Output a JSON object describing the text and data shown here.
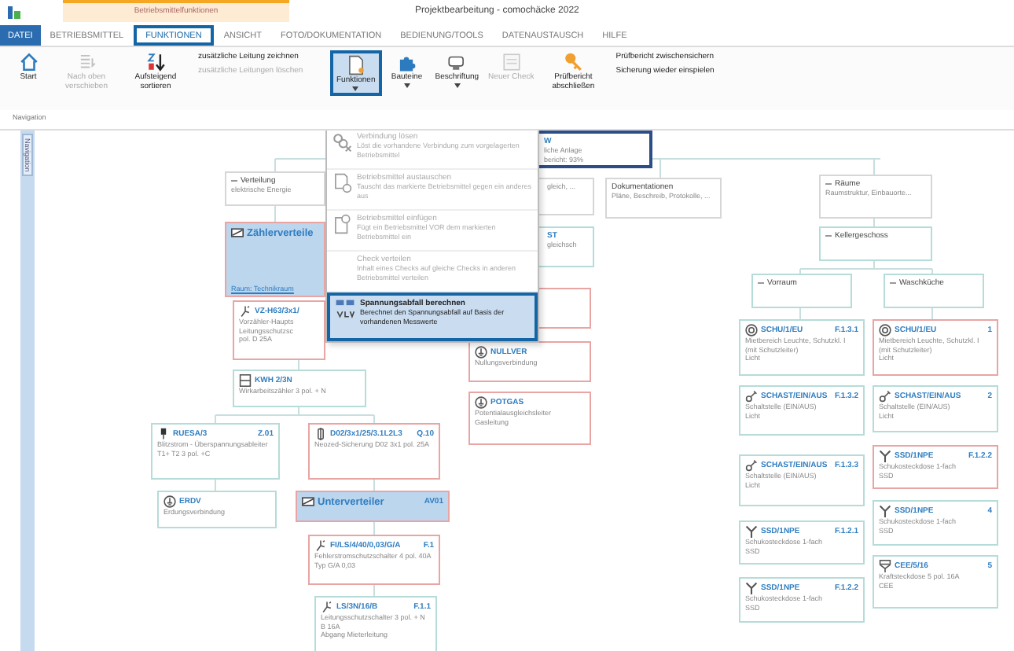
{
  "window": {
    "context_tab": "Betriebsmittelfunktionen",
    "title": "Projektbearbeitung - comochäcke 2022"
  },
  "tabs": [
    {
      "label": "DATEI",
      "kind": "file",
      "selected": false
    },
    {
      "label": "BETRIEBSMITTEL",
      "kind": "tab",
      "selected": false
    },
    {
      "label": "FUNKTIONEN",
      "kind": "tab",
      "selected": true
    },
    {
      "label": "ANSICHT",
      "kind": "tab",
      "selected": false
    },
    {
      "label": "FOTO/DOKUMENTATION",
      "kind": "tab",
      "selected": false
    },
    {
      "label": "BEDIENUNG/TOOLS",
      "kind": "tab",
      "selected": false
    },
    {
      "label": "DATENAUSTAUSCH",
      "kind": "tab",
      "selected": false
    },
    {
      "label": "HILFE",
      "kind": "tab",
      "selected": false
    }
  ],
  "ribbon": {
    "group_label": "Navigation",
    "items": [
      {
        "kind": "large",
        "label": "Start",
        "disabled": false,
        "selected": false,
        "dropdown": false
      },
      {
        "kind": "large",
        "label": "Nach oben verschieben",
        "disabled": true,
        "selected": false,
        "dropdown": false
      },
      {
        "kind": "large",
        "label": "Aufsteigend sortieren",
        "disabled": false,
        "selected": false,
        "dropdown": false
      },
      {
        "kind": "stack",
        "entries": [
          {
            "label": "zusätzliche Leitung zeichnen",
            "disabled": false
          },
          {
            "label": "zusätzliche Leitungen löschen",
            "disabled": true
          }
        ]
      },
      {
        "kind": "large",
        "label": "Funktionen",
        "disabled": false,
        "selected": true,
        "dropdown": true
      },
      {
        "kind": "large",
        "label": "Bauteine",
        "disabled": false,
        "selected": false,
        "dropdown": true
      },
      {
        "kind": "large",
        "label": "Beschriftung",
        "disabled": false,
        "selected": false,
        "dropdown": true
      },
      {
        "kind": "large",
        "label": "Neuer Check",
        "disabled": true,
        "selected": false,
        "dropdown": false
      },
      {
        "kind": "large",
        "label": "Prüfbericht abschließen",
        "disabled": false,
        "selected": false,
        "dropdown": false
      },
      {
        "kind": "stack",
        "entries": [
          {
            "label": "Prüfbericht zwischensichern",
            "disabled": false
          },
          {
            "label": "Sicherung wieder einspielen",
            "disabled": false
          }
        ]
      }
    ]
  },
  "side_panel": {
    "label": "Navigation"
  },
  "nodes": [
    {
      "kind": "group",
      "title": "Verteilung",
      "lines": [
        "elektrische Energie"
      ],
      "color": "#d6d6d6",
      "selected": false,
      "expanded": true
    },
    {
      "kind": "distributor",
      "title": "Zählerverteile",
      "footer": "Raum: Technikraum",
      "color": "#e9a4a4",
      "selected": true
    },
    {
      "kind": "breaker",
      "title": "VZ-H63/3x1/",
      "lines": [
        "Vorzähler-Haupts",
        "Leitungsschutzsc",
        "pol. D 25A"
      ],
      "color": "#e9a4a4",
      "selected": false
    },
    {
      "kind": "meter",
      "title": "KWH 2/3N",
      "lines": [
        "Wirkarbeitszähler 3 pol. + N"
      ],
      "color": "#b5dcd9",
      "selected": false
    },
    {
      "kind": "arrester",
      "title": "RUESA/3",
      "code": "Z.01",
      "lines": [
        "Blitzstrom - Überspannungsableiter T1+ T2 3 pol. +C"
      ],
      "color": "#b5dcd9",
      "selected": false
    },
    {
      "kind": "earth",
      "title": "ERDV",
      "lines": [
        "Erdungsverbindung"
      ],
      "color": "#b5dcd9",
      "selected": false
    },
    {
      "kind": "fuse",
      "title": "D02/3x1/25/3.1L2L3",
      "code": "Q.10",
      "lines": [
        "Neozed-Sicherung D02 3x1 pol. 25A"
      ],
      "color": "#e9a4a4",
      "selected": false
    },
    {
      "kind": "distributor",
      "title": "Unterverteiler",
      "code": "AV01",
      "color": "#e9a4a4",
      "selected": true
    },
    {
      "kind": "breaker",
      "title": "FI/LS/4/40/0,03/G/A",
      "code": "F.1",
      "lines": [
        "Fehlerstromschutzschalter 4 pol. 40A Typ G/A 0,03"
      ],
      "color": "#e9a4a4",
      "selected": false
    },
    {
      "kind": "breaker",
      "title": "LS/3N/16/B",
      "code": "F.1.1",
      "lines": [
        "Leitungsschutzschalter 3 pol. + N B 16A",
        "Abgang Mieterleitung"
      ],
      "color": "#b5dcd9",
      "selected": false
    },
    {
      "kind": "plain",
      "title": "W",
      "lines": [
        "liche Anlage",
        "bericht: 93%"
      ],
      "color": "#2c4d85",
      "selected": false
    },
    {
      "kind": "plain",
      "lines": [
        "gleich, ..."
      ],
      "color": "#d6d6d6",
      "selected": false
    },
    {
      "kind": "plain",
      "title": "ST",
      "lines": [
        "gleichsch"
      ],
      "color": "#b5dcd9",
      "selected": false
    },
    {
      "kind": "plain",
      "color": "#e9a4a4",
      "selected": false
    },
    {
      "kind": "earth",
      "title": "NULLVER",
      "lines": [
        "Nullungsverbindung"
      ],
      "color": "#e9a4a4",
      "selected": false
    },
    {
      "kind": "earth",
      "title": "POTGAS",
      "lines": [
        "Potentialausgleichsleiter Gasleitung"
      ],
      "color": "#e9a4a4",
      "selected": false
    },
    {
      "kind": "folder",
      "title": "Dokumentationen",
      "lines": [
        "Pläne, Beschreib, Protokolle, ..."
      ],
      "color": "#d6d6d6",
      "selected": false
    },
    {
      "kind": "group",
      "title": "Räume",
      "lines": [
        "Raumstruktur, Einbauorte..."
      ],
      "color": "#d6d6d6",
      "selected": false,
      "expanded": true
    },
    {
      "kind": "group",
      "title": "Kellergeschoss",
      "color": "#b5dcd9",
      "selected": false,
      "expanded": true
    },
    {
      "kind": "group",
      "title": "Vorraum",
      "color": "#b5dcd9",
      "selected": false,
      "expanded": true
    },
    {
      "kind": "group",
      "title": "Waschküche",
      "color": "#b5dcd9",
      "selected": false,
      "expanded": true
    },
    {
      "kind": "lamp",
      "title": "SCHU/1/EU",
      "code": "F.1.3.1",
      "lines": [
        "Mietbereich Leuchte, Schutzkl. I (mit Schutzleiter)",
        "Licht"
      ],
      "color": "#b5dcd9",
      "selected": false
    },
    {
      "kind": "switch",
      "title": "SCHAST/EIN/AUS",
      "code": "F.1.3.2",
      "lines": [
        "Schaltstelle (EIN/AUS)",
        "Licht"
      ],
      "color": "#b5dcd9",
      "selected": false
    },
    {
      "kind": "switch",
      "title": "SCHAST/EIN/AUS",
      "code": "F.1.3.3",
      "lines": [
        "Schaltstelle (EIN/AUS)",
        "Licht"
      ],
      "color": "#b5dcd9",
      "selected": false
    },
    {
      "kind": "socket",
      "title": "SSD/1NPE",
      "code": "F.1.2.1",
      "lines": [
        "Schukosteckdose 1-fach",
        "SSD"
      ],
      "color": "#b5dcd9",
      "selected": false
    },
    {
      "kind": "socket",
      "title": "SSD/1NPE",
      "code": "F.1.2.2",
      "lines": [
        "Schukosteckdose 1-fach",
        "SSD"
      ],
      "color": "#b5dcd9",
      "selected": false
    },
    {
      "kind": "lamp",
      "title": "SCHU/1/EU",
      "code": "1",
      "lines": [
        "Mietbereich Leuchte, Schutzkl. I (mit Schutzleiter)",
        "Licht"
      ],
      "color": "#e9a4a4",
      "selected": false
    },
    {
      "kind": "switch",
      "title": "SCHAST/EIN/AUS",
      "code": "2",
      "lines": [
        "Schaltstelle (EIN/AUS)",
        "Licht"
      ],
      "color": "#b5dcd9",
      "selected": false
    },
    {
      "kind": "socket",
      "title": "SSD/1NPE",
      "code": "F.1.2.2",
      "lines": [
        "Schukosteckdose 1-fach",
        "SSD"
      ],
      "color": "#e9a4a4",
      "selected": false
    },
    {
      "kind": "socket",
      "title": "SSD/1NPE",
      "code": "4",
      "lines": [
        "Schukosteckdose 1-fach",
        "SSD"
      ],
      "color": "#b5dcd9",
      "selected": false
    },
    {
      "kind": "cee",
      "title": "CEE/5/16",
      "code": "5",
      "lines": [
        "Kraftsteckdose 5 pol. 16A",
        "CEE"
      ],
      "color": "#b5dcd9",
      "selected": false
    }
  ],
  "menu": {
    "items": [
      {
        "title": "Verbindung lösen",
        "description": "Löst die vorhandene Verbindung zum vorgelagerten Betriebsmittel",
        "disabled": true,
        "selected": false
      },
      {
        "title": "Betriebsmittel austauschen",
        "description": "Tauscht das markierte Betriebsmittel gegen ein anderes aus",
        "disabled": true,
        "selected": false
      },
      {
        "title": "Betriebsmittel einfügen",
        "description": "Fügt ein Betriebsmittel VOR dem markierten Betriebsmittel ein",
        "disabled": true,
        "selected": false
      },
      {
        "title": "Check verteilen",
        "description": "Inhalt eines Checks auf gleiche Checks in anderen Betriebsmittel verteilen",
        "disabled": true,
        "selected": false
      },
      {
        "title": "Spannungsabfall berechnen",
        "description": "Berechnet den Spannungsabfall auf Basis der vorhandenen Messwerte",
        "disabled": false,
        "selected": true
      }
    ]
  }
}
